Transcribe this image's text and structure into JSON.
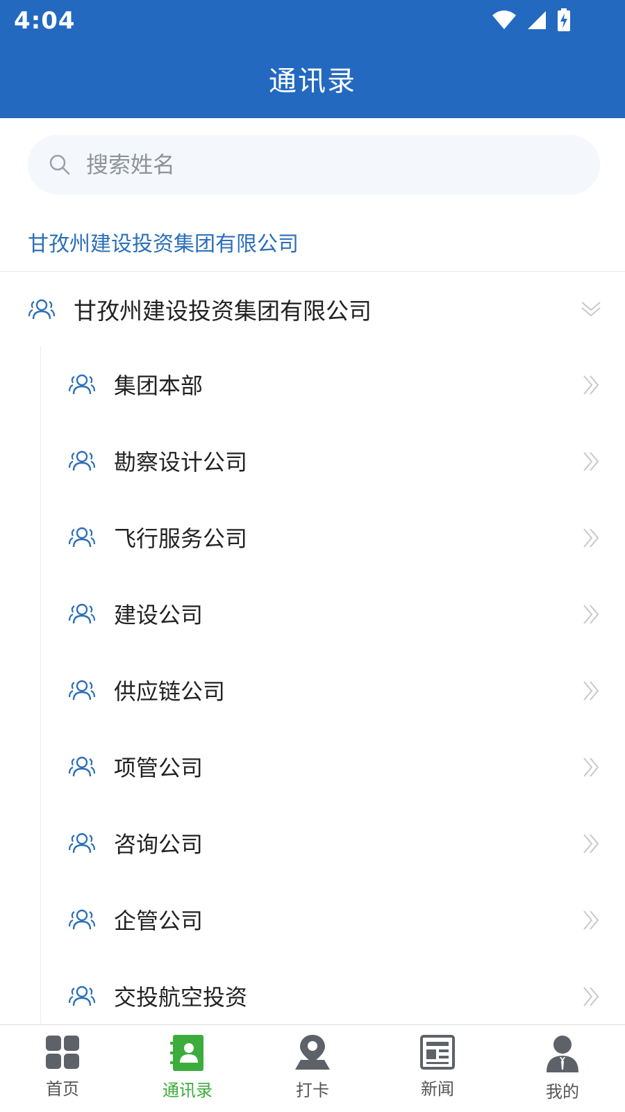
{
  "status_bar": {
    "time": "4:04"
  },
  "header": {
    "title": "通讯录"
  },
  "search": {
    "placeholder": "搜索姓名"
  },
  "breadcrumb": {
    "label": "甘孜州建设投资集团有限公司"
  },
  "tree": {
    "root": {
      "label": "甘孜州建设投资集团有限公司",
      "expanded": true
    },
    "children": [
      {
        "label": "集团本部"
      },
      {
        "label": "勘察设计公司"
      },
      {
        "label": "飞行服务公司"
      },
      {
        "label": "建设公司"
      },
      {
        "label": "供应链公司"
      },
      {
        "label": "项管公司"
      },
      {
        "label": "咨询公司"
      },
      {
        "label": "企管公司"
      },
      {
        "label": "交投航空投资"
      }
    ]
  },
  "tabbar": {
    "tabs": [
      {
        "label": "首页",
        "icon": "grid-icon",
        "active": false
      },
      {
        "label": "通讯录",
        "icon": "contacts-book-icon",
        "active": true
      },
      {
        "label": "打卡",
        "icon": "location-pin-icon",
        "active": false
      },
      {
        "label": "新闻",
        "icon": "news-icon",
        "active": false
      },
      {
        "label": "我的",
        "icon": "user-icon",
        "active": false
      }
    ]
  },
  "colors": {
    "header_bg": "#2369c0",
    "accent_blue": "#2b6fb8",
    "active_tab": "#3cac3c",
    "inactive_tab": "#555555",
    "search_bg": "#f4f7fb"
  }
}
